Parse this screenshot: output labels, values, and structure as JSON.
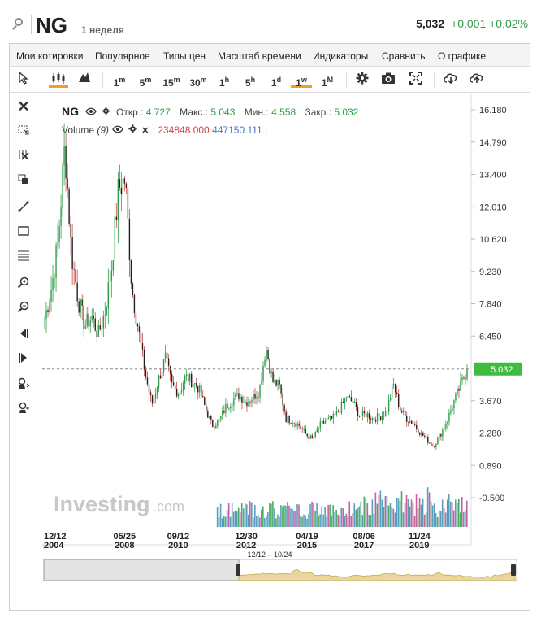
{
  "header": {
    "symbol": "NG",
    "period": "1 неделя",
    "last": "5,032",
    "change": "+0,001",
    "change_pct": "+0,02%"
  },
  "menu": [
    "Мои котировки",
    "Популярное",
    "Типы цен",
    "Масштаб времени",
    "Индикаторы",
    "Сравнить",
    "О графике"
  ],
  "toolbar": {
    "intervals": [
      "1",
      "5",
      "15",
      "30",
      "1",
      "5",
      "1",
      "1",
      "1"
    ],
    "interval_units": [
      "m",
      "m",
      "m",
      "m",
      "h",
      "h",
      "d",
      "w",
      "M"
    ],
    "active_interval": "1w"
  },
  "legend": {
    "symbol": "NG",
    "open_label": "Откр.:",
    "open": "4.727",
    "high_label": "Макс.:",
    "high": "5.043",
    "low_label": "Мин.:",
    "low": "4.558",
    "close_label": "Закр.:",
    "close": "5.032",
    "volume_label": "Volume",
    "volume_param": "(9)",
    "volume_v1": "234848.000",
    "volume_v2": "447150.111",
    "volume_sep": ":"
  },
  "watermark": {
    "brand": "Investing",
    "suffix": ".com"
  },
  "current_price_tag": "5.032",
  "navigator_range": "12/12 – 10/24",
  "colors": {
    "up": "#2e9c48",
    "down": "#d04848",
    "accent": "#f0a020",
    "price_tag": "#3fbb3f",
    "volume": "#3a8fb0"
  },
  "chart_data": {
    "type": "candlestick",
    "y_ticks": [
      "16.180",
      "14.790",
      "13.400",
      "12.010",
      "10.620",
      "9.230",
      "7.840",
      "6.450",
      "3.670",
      "2.280",
      "0.890",
      "-0.500"
    ],
    "x_ticks": [
      {
        "date": "12/12",
        "year": "2004"
      },
      {
        "date": "05/25",
        "year": "2008"
      },
      {
        "date": "09/12",
        "year": "2010"
      },
      {
        "date": "12/30",
        "year": "2012"
      },
      {
        "date": "04/19",
        "year": "2015"
      },
      {
        "date": "08/06",
        "year": "2017"
      },
      {
        "date": "11/24",
        "year": "2019"
      }
    ],
    "series_close": [
      7.2,
      8.5,
      10.5,
      14.7,
      10.0,
      8.0,
      6.9,
      7.3,
      6.5,
      7.5,
      9.5,
      12.8,
      13.2,
      8.5,
      6.7,
      4.8,
      3.5,
      4.6,
      5.5,
      4.3,
      4.0,
      4.7,
      4.5,
      4.2,
      3.3,
      2.6,
      2.8,
      3.4,
      3.7,
      3.9,
      3.6,
      3.8,
      4.1,
      6.0,
      4.5,
      4.3,
      2.9,
      2.8,
      2.6,
      2.2,
      2.0,
      2.6,
      2.8,
      2.9,
      3.3,
      3.8,
      3.6,
      3.0,
      3.1,
      2.9,
      3.0,
      3.2,
      4.4,
      3.3,
      2.9,
      2.7,
      2.3,
      2.0,
      1.7,
      2.2,
      2.8,
      3.6,
      4.3,
      5.03
    ],
    "current": 5.032,
    "ylim": [
      -0.5,
      16.18
    ]
  }
}
